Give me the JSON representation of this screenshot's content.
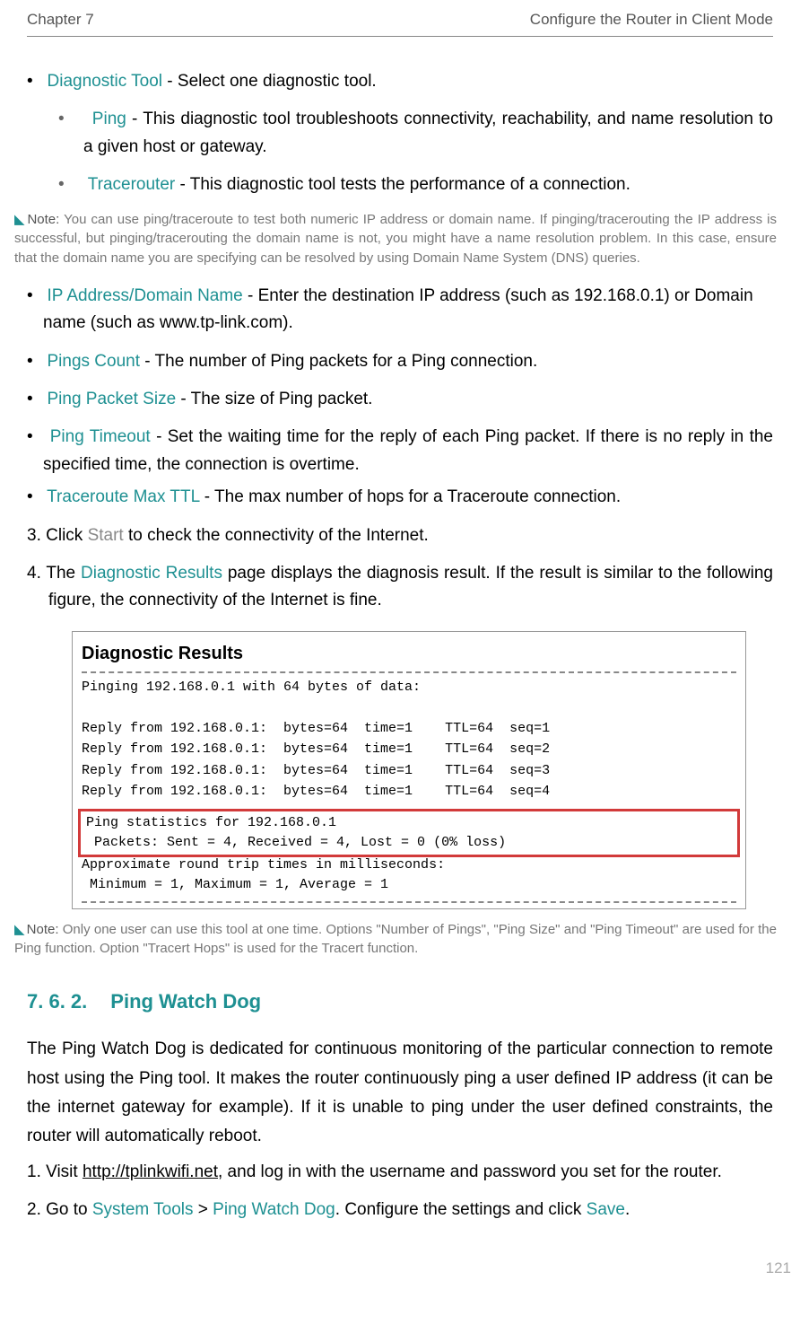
{
  "header": {
    "chapter": "Chapter 7",
    "title": "Configure the Router in Client Mode"
  },
  "bullets": {
    "diag_tool_term": "Diagnostic Tool",
    "diag_tool_text": " - Select one diagnostic tool.",
    "ping_term": "Ping",
    "ping_text": " - This diagnostic tool troubleshoots connectivity, reachability, and name resolution to a given host or gateway.",
    "tracerouter_term": "Tracerouter",
    "tracerouter_text": " - This diagnostic tool tests the performance of a connection.",
    "ip_addr_term": "IP Address/Domain Name",
    "ip_addr_text": " - Enter the destination IP address (such as 192.168.0.1) or Domain name (such as www.tp-link.com).",
    "pings_count_term": "Pings Count",
    "pings_count_text": " - The number of Ping packets for a Ping connection.",
    "ping_packet_term": "Ping Packet Size",
    "ping_packet_text": " - The size of Ping packet.",
    "ping_timeout_term": "Ping Timeout",
    "ping_timeout_text": " - Set the waiting time for the reply of each Ping packet. If there is no reply in the specified time, the connection is overtime.",
    "traceroute_ttl_term": "Traceroute Max TTL",
    "traceroute_ttl_text": " - The max number of hops for a Traceroute connection."
  },
  "note1": {
    "label": "Note:",
    "text": " You can use ping/traceroute to test both numeric IP address or domain name. If pinging/tracerouting the IP address is successful, but pinging/tracerouting the domain name is not, you might have a name resolution problem. In this case, ensure that the domain name you are specifying can be resolved by using Domain Name System (DNS) queries."
  },
  "step3": {
    "prefix": "3. Click ",
    "start": "Start",
    "suffix": " to check the connectivity of the Internet."
  },
  "step4": {
    "prefix": "4. The ",
    "diag_results": "Diagnostic Results",
    "suffix": " page displays the diagnosis result. If the result is similar to the following figure, the connectivity of the Internet is fine."
  },
  "diag": {
    "title": "Diagnostic Results",
    "line1": "Pinging 192.168.0.1 with 64 bytes of data:",
    "reply1": "Reply from 192.168.0.1:  bytes=64  time=1    TTL=64  seq=1",
    "reply2": "Reply from 192.168.0.1:  bytes=64  time=1    TTL=64  seq=2",
    "reply3": "Reply from 192.168.0.1:  bytes=64  time=1    TTL=64  seq=3",
    "reply4": "Reply from 192.168.0.1:  bytes=64  time=1    TTL=64  seq=4",
    "stats1": "Ping statistics for 192.168.0.1",
    "stats2": " Packets: Sent = 4, Received = 4, Lost = 0 (0% loss)",
    "approx": "Approximate round trip times in milliseconds:",
    "minmax": " Minimum = 1, Maximum = 1, Average = 1"
  },
  "note2": {
    "label": "Note:",
    "text": " Only one user can use this tool at one time. Options \"Number of Pings\", \"Ping Size\" and \"Ping Timeout\" are used for the Ping function. Option \"Tracert Hops\" is used for the Tracert function."
  },
  "section": {
    "num": "7. 6. 2.",
    "title": "Ping Watch Dog"
  },
  "pwd_para": "The Ping Watch Dog is dedicated for continuous monitoring of the particular connection to remote host using the Ping tool. It makes the router continuously ping a user defined IP address (it can be the internet gateway for example). If it is unable to ping under the user defined constraints, the router will automatically reboot.",
  "pwd_step1": {
    "prefix": "1. Visit ",
    "url": "http://tplinkwifi.net",
    "suffix": ", and log in with the username and password you set for the router."
  },
  "pwd_step2": {
    "prefix": "2. Go to ",
    "systools": "System Tools",
    "gt": " > ",
    "pwd": "Ping Watch Dog",
    "mid": ". Configure the settings and click ",
    "save": "Save",
    "end": "."
  },
  "page_number": "121"
}
